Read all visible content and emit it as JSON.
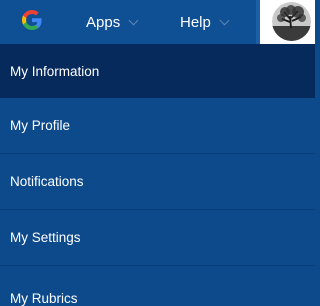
{
  "topbar": {
    "logo_icon": "google-g-icon",
    "apps_label": "Apps",
    "help_label": "Help",
    "avatar_icon": "user-avatar"
  },
  "menu": {
    "items": [
      {
        "label": "My Information",
        "active": true
      },
      {
        "label": "My Profile",
        "active": false
      },
      {
        "label": "Notifications",
        "active": false
      },
      {
        "label": "My Settings",
        "active": false
      },
      {
        "label": "My Rubrics",
        "active": false
      }
    ]
  },
  "colors": {
    "background": "#0d4a8c",
    "active_item": "#062a5c",
    "topbar": "#0f4f93"
  }
}
